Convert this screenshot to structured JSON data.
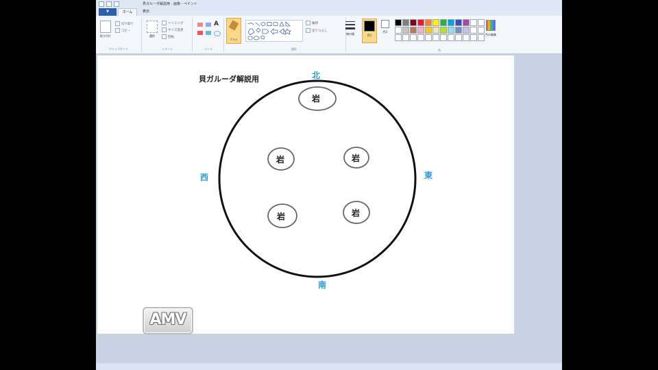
{
  "window": {
    "title": "貝ガルーダ解説用 - 画像 - ペイント"
  },
  "tabs": [
    {
      "label": "▼"
    },
    {
      "label": "ホーム"
    },
    {
      "label": "表示"
    }
  ],
  "ribbon": {
    "clipboard": {
      "group_label": "クリップボード",
      "paste_label": "貼り付け",
      "cut_label": "切り取り",
      "copy_label": "コピー"
    },
    "image": {
      "group_label": "イメージ",
      "select_label": "選択",
      "crop_label": "トリミング",
      "resize_label": "サイズ変更",
      "rotate_label": "回転"
    },
    "tools": {
      "group_label": "ツール"
    },
    "brushes": {
      "label": "ブラシ"
    },
    "shapes": {
      "group_label": "図形",
      "outline_label": "輪郭",
      "fill_label": "塗りつぶし"
    },
    "size": {
      "label": "線の幅"
    },
    "colors": {
      "group_label": "色",
      "color1_label": "色1",
      "color2_label": "色2",
      "edit_label": "色の編集"
    },
    "color1_value": "#000000",
    "color2_value": "#ffffff",
    "palette": [
      "#000000",
      "#7f7f7f",
      "#880015",
      "#ed1c24",
      "#ff7f27",
      "#fff200",
      "#22b14c",
      "#00a2e8",
      "#3f48cc",
      "#a349a4",
      "#ffffff",
      "#ffffff",
      "#ffffff",
      "#c3c3c3",
      "#b97a57",
      "#ffaec9",
      "#ffc90e",
      "#efe4b0",
      "#b5e61d",
      "#99d9ea",
      "#7092be",
      "#c8bfe7",
      "#ffffff",
      "#ffffff",
      "#ffffff",
      "#ffffff",
      "#ffffff",
      "#ffffff",
      "#ffffff",
      "#ffffff",
      "#ffffff",
      "#ffffff",
      "#ffffff",
      "#ffffff",
      "#ffffff",
      "#ffffff"
    ]
  },
  "canvas": {
    "heading": "貝ガルーダ解説用",
    "directions": {
      "north": "北",
      "south": "南",
      "east": "東",
      "west": "西"
    },
    "rocks": [
      "岩",
      "岩",
      "岩",
      "岩",
      "岩"
    ],
    "logo": "AMV"
  }
}
